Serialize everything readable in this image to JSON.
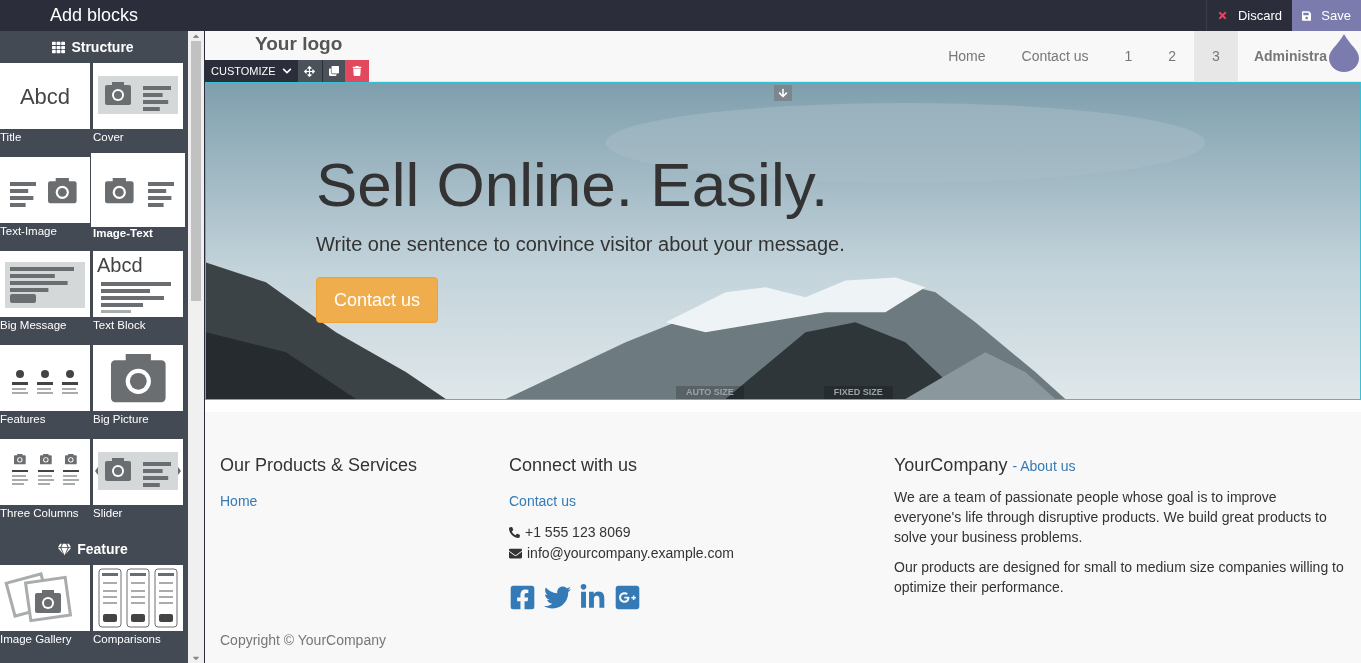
{
  "sidebar": {
    "title": "Add blocks",
    "sections": [
      {
        "title": "Structure",
        "blocks": [
          {
            "label": "Title",
            "kind": "title",
            "thumb_text": "Abcd",
            "selected": false
          },
          {
            "label": "Cover",
            "kind": "cover",
            "selected": false
          },
          {
            "label": "Text-Image",
            "kind": "text-image",
            "selected": false
          },
          {
            "label": "Image-Text",
            "kind": "image-text",
            "selected": true
          },
          {
            "label": "Big Message",
            "kind": "message",
            "selected": false
          },
          {
            "label": "Text Block",
            "kind": "textblock",
            "thumb_text": "Abcd",
            "selected": false
          },
          {
            "label": "Features",
            "kind": "features",
            "selected": false
          },
          {
            "label": "Big Picture",
            "kind": "bigpicture",
            "selected": false
          },
          {
            "label": "Three Columns",
            "kind": "columns",
            "selected": false
          },
          {
            "label": "Slider",
            "kind": "slider",
            "selected": false
          }
        ]
      },
      {
        "title": "Feature",
        "blocks": [
          {
            "label": "Image Gallery",
            "kind": "gallery",
            "selected": false
          },
          {
            "label": "Comparisons",
            "kind": "comparisons",
            "selected": false
          }
        ]
      }
    ]
  },
  "topbar": {
    "discard": "Discard",
    "save": "Save"
  },
  "navbar": {
    "logo": "Your logo",
    "items": [
      {
        "label": "Home",
        "selected": false
      },
      {
        "label": "Contact us",
        "selected": false
      },
      {
        "label": "1",
        "selected": false
      },
      {
        "label": "2",
        "selected": false
      },
      {
        "label": "3",
        "selected": true
      }
    ],
    "user": "Administra"
  },
  "toolbar": {
    "label": "CUSTOMIZE"
  },
  "hero": {
    "title": "Sell Online. Easily.",
    "subtitle": "Write one sentence to convince visitor about your message.",
    "button": "Contact us",
    "size_labels": [
      "AUTO SIZE",
      "FIXED SIZE"
    ]
  },
  "footer": {
    "col1": {
      "title": "Our Products & Services",
      "links": [
        "Home"
      ]
    },
    "col2": {
      "title": "Connect with us",
      "links": [
        "Contact us"
      ],
      "phone": "+1 555 123 8069",
      "email": "info@yourcompany.example.com"
    },
    "col3": {
      "title": "YourCompany",
      "link": "- About us",
      "paragraphs": [
        "We are a team of passionate people whose goal is to improve everyone's life through disruptive products. We build great products to solve your business problems.",
        "Our products are designed for small to medium size companies willing to optimize their performance."
      ]
    },
    "copyright": "Copyright © YourCompany"
  }
}
